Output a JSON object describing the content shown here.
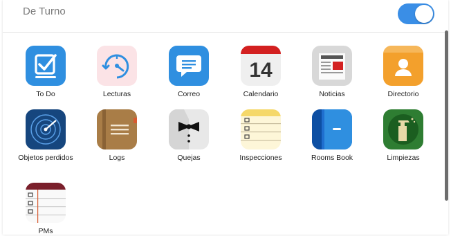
{
  "header": {
    "title": "De Turno",
    "toggle_on": true
  },
  "apps": [
    {
      "label": "To Do",
      "icon": "todo-checkbox-icon"
    },
    {
      "label": "Lecturas",
      "icon": "gauge-reading-icon"
    },
    {
      "label": "Correo",
      "icon": "mail-bubble-icon"
    },
    {
      "label": "Calendario",
      "icon": "calendar-icon",
      "date": "14"
    },
    {
      "label": "Noticias",
      "icon": "newspaper-icon"
    },
    {
      "label": "Directorio",
      "icon": "contact-book-icon"
    },
    {
      "label": "Objetos perdidos",
      "icon": "radar-icon"
    },
    {
      "label": "Logs",
      "icon": "logbook-icon"
    },
    {
      "label": "Quejas",
      "icon": "tuxedo-bowtie-icon"
    },
    {
      "label": "Inspecciones",
      "icon": "notepad-checklist-icon"
    },
    {
      "label": "Rooms Book",
      "icon": "door-icon"
    },
    {
      "label": "Limpiezas",
      "icon": "spray-bottle-icon"
    },
    {
      "label": "PMs",
      "icon": "checklist-notebook-icon"
    }
  ],
  "colors": {
    "toggle": "#3a8ee6",
    "todo": "#2f8fe0",
    "correo": "#2f8fe0",
    "directorio": "#f3a02c",
    "rooms_book": "#1f6fcf",
    "limpiezas": "#2e7d32"
  }
}
